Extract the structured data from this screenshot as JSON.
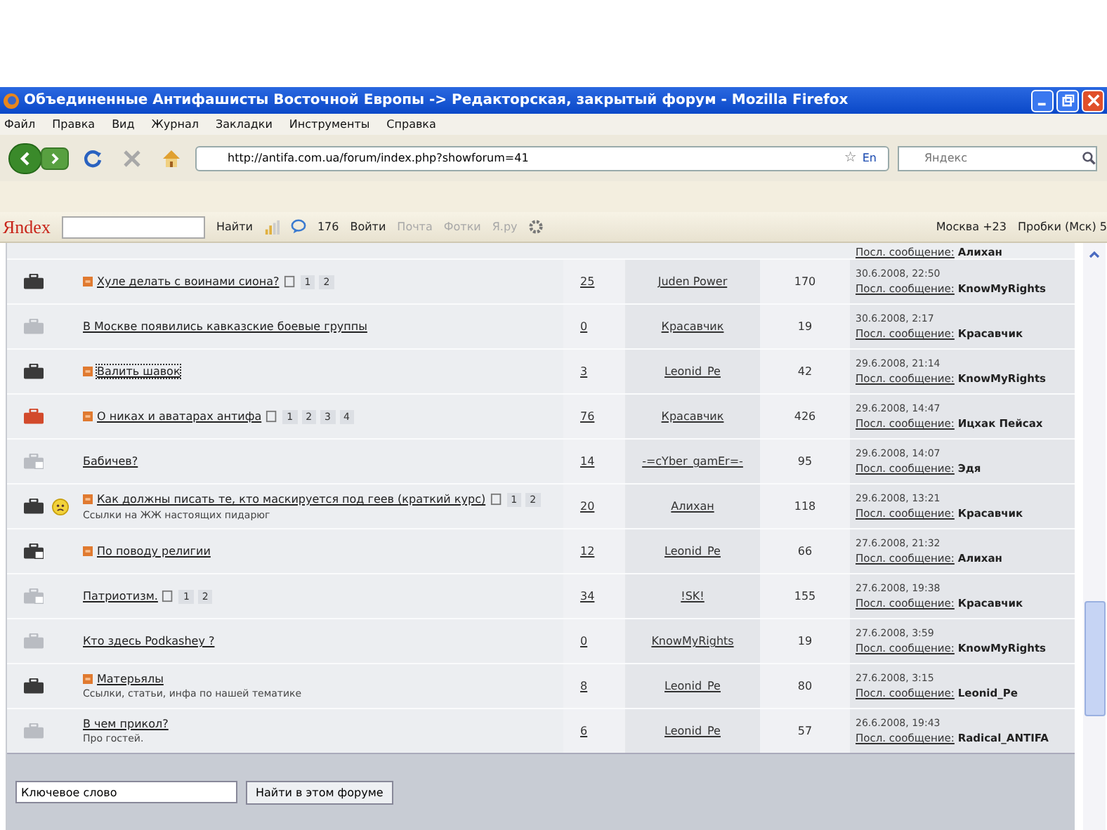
{
  "window": {
    "title": "Объединенные Антифашисты Восточной Европы -> Редакторская, закрытый форум - Mozilla Firefox"
  },
  "menu": [
    "Файл",
    "Правка",
    "Вид",
    "Журнал",
    "Закладки",
    "Инструменты",
    "Справка"
  ],
  "address_bar": {
    "url": "http://antifa.com.ua/forum/index.php?showforum=41",
    "bookmark_star": "☆",
    "language": "En"
  },
  "web_search": {
    "placeholder": "Яндекс"
  },
  "yandex_bar": {
    "logo": "Яndex",
    "find": "Найти",
    "count": "176",
    "login": "Войти",
    "mail": "Почта",
    "photos": "Фотки",
    "yaru": "Я.ру",
    "weather": "Москва +23",
    "traffic": "Пробки (Мск) 5"
  },
  "partial_row": {
    "last_post_label": "Посл. сообщение:",
    "last_by": "Алихан"
  },
  "rows": [
    {
      "kind": "hot",
      "new": true,
      "smiley": false,
      "focused": false,
      "title": "Хуле делать с воинами сиона?",
      "pages": [
        "1",
        "2"
      ],
      "replies": "25",
      "author": "Juden Power",
      "views": "170",
      "date": "30.6.2008, 22:50",
      "last_post_label": "Посл. сообщение:",
      "last_by": "KnowMyRights"
    },
    {
      "kind": "cold",
      "new": false,
      "smiley": false,
      "focused": false,
      "title": "В Москве появились кавказские боевые группы",
      "replies": "0",
      "author": "Красавчик",
      "views": "19",
      "date": "30.6.2008, 2:17",
      "last_post_label": "Посл. сообщение:",
      "last_by": "Красавчик"
    },
    {
      "kind": "hot",
      "new": true,
      "smiley": false,
      "focused": true,
      "title": "Валить шавок",
      "replies": "3",
      "author": "Leonid_Pe",
      "views": "42",
      "date": "29.6.2008, 21:14",
      "last_post_label": "Посл. сообщение:",
      "last_by": "KnowMyRights"
    },
    {
      "kind": "hot_red",
      "new": true,
      "smiley": false,
      "focused": false,
      "title": "О никах и аватарах антифа",
      "pages": [
        "1",
        "2",
        "3",
        "4"
      ],
      "replies": "76",
      "author": "Красавчик",
      "views": "426",
      "date": "29.6.2008, 14:47",
      "last_post_label": "Посл. сообщение:",
      "last_by": "Ицхак Пейсах"
    },
    {
      "kind": "cold_stack",
      "new": false,
      "smiley": false,
      "focused": false,
      "title": "Бабичев?",
      "replies": "14",
      "author": "-=cYber_gamEr=-",
      "views": "95",
      "date": "29.6.2008, 14:07",
      "last_post_label": "Посл. сообщение:",
      "last_by": "Эдя"
    },
    {
      "kind": "hot",
      "new": true,
      "smiley": true,
      "focused": false,
      "title": "Как должны писать те, кто маскируется под геев (краткий курс)",
      "pages": [
        "1",
        "2"
      ],
      "description": "Ссылки на ЖЖ настоящих пидарюг",
      "replies": "20",
      "author": "Алихан",
      "views": "118",
      "date": "29.6.2008, 13:21",
      "last_post_label": "Посл. сообщение:",
      "last_by": "Красавчик"
    },
    {
      "kind": "hot_stack",
      "new": true,
      "smiley": false,
      "focused": false,
      "title": "По поводу религии",
      "replies": "12",
      "author": "Leonid_Pe",
      "views": "66",
      "date": "27.6.2008, 21:32",
      "last_post_label": "Посл. сообщение:",
      "last_by": "Алихан"
    },
    {
      "kind": "cold_stack",
      "new": false,
      "smiley": false,
      "focused": false,
      "title": "Патриотизм.",
      "pages": [
        "1",
        "2"
      ],
      "replies": "34",
      "author": "!SK!",
      "views": "155",
      "date": "27.6.2008, 19:38",
      "last_post_label": "Посл. сообщение:",
      "last_by": "Красавчик"
    },
    {
      "kind": "cold",
      "new": false,
      "smiley": false,
      "focused": false,
      "title": "Кто здесь Podkashey ?",
      "replies": "0",
      "author": "KnowMyRights",
      "views": "19",
      "date": "27.6.2008, 3:59",
      "last_post_label": "Посл. сообщение:",
      "last_by": "KnowMyRights"
    },
    {
      "kind": "hot",
      "new": true,
      "smiley": false,
      "focused": false,
      "title": "Матерьялы",
      "description": "Ссылки, статьи, инфа по нашей тематике",
      "replies": "8",
      "author": "Leonid_Pe",
      "views": "80",
      "date": "27.6.2008, 3:15",
      "last_post_label": "Посл. сообщение:",
      "last_by": "Leonid_Pe"
    },
    {
      "kind": "cold",
      "new": false,
      "smiley": false,
      "focused": false,
      "title": "В чем прикол?",
      "description": "Про гостей.",
      "replies": "6",
      "author": "Leonid_Pe",
      "views": "57",
      "date": "26.6.2008, 19:43",
      "last_post_label": "Посл. сообщение:",
      "last_by": "Radical_ANTIFA"
    }
  ],
  "forum_search": {
    "value": "Ключевое слово",
    "button": "Найти в этом форуме"
  }
}
